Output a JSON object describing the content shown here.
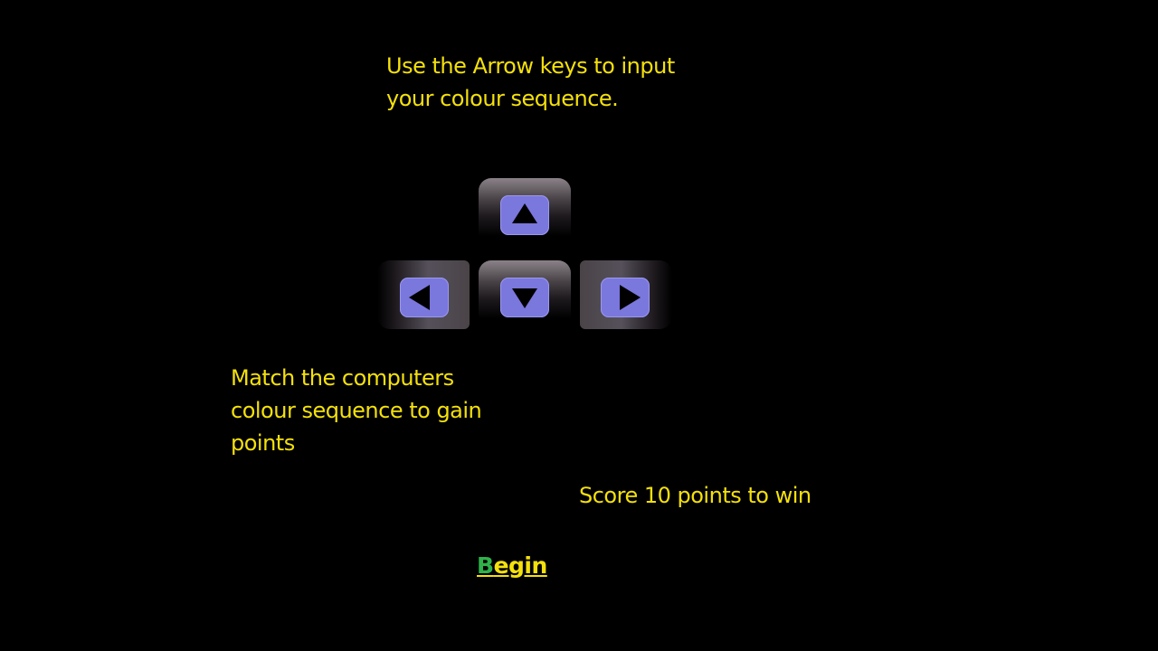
{
  "instructions": {
    "arrow_keys": "Use the Arrow keys to input your colour sequence.",
    "match": "Match the computers colour sequence to gain points",
    "score": "Score 10 points to win"
  },
  "begin": {
    "first_letter": "B",
    "rest": "egin"
  },
  "colors": {
    "background": "#000000",
    "text": "#f4e00c",
    "begin_first_letter": "#2fb24a",
    "arrow_button": "#7a77dd"
  },
  "keys": [
    {
      "id": "up",
      "icon": "arrow-up-icon"
    },
    {
      "id": "left",
      "icon": "arrow-left-icon"
    },
    {
      "id": "down",
      "icon": "arrow-down-icon"
    },
    {
      "id": "right",
      "icon": "arrow-right-icon"
    }
  ]
}
